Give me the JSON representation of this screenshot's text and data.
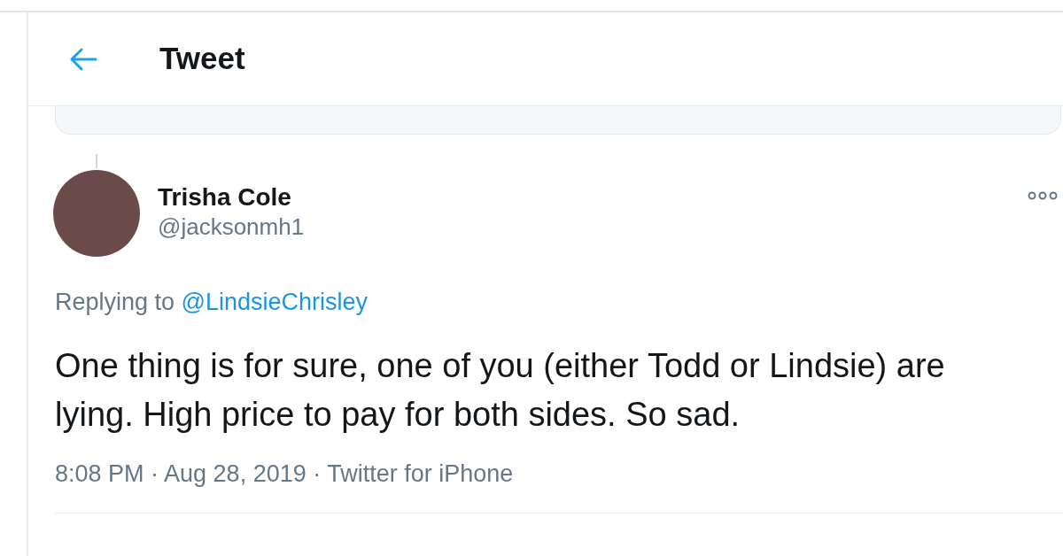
{
  "header": {
    "title": "Tweet"
  },
  "tweet": {
    "name": "Trisha Cole",
    "handle": "@jacksonmh1",
    "replying_prefix": "Replying to",
    "replying_to": "@LindsieChrisley",
    "text": "One thing is for sure, one of you (either Todd or Lindsie) are lying. High price to pay for both sides. So sad.",
    "meta": "8:08 PM · Aug 28, 2019 · Twitter for iPhone"
  }
}
